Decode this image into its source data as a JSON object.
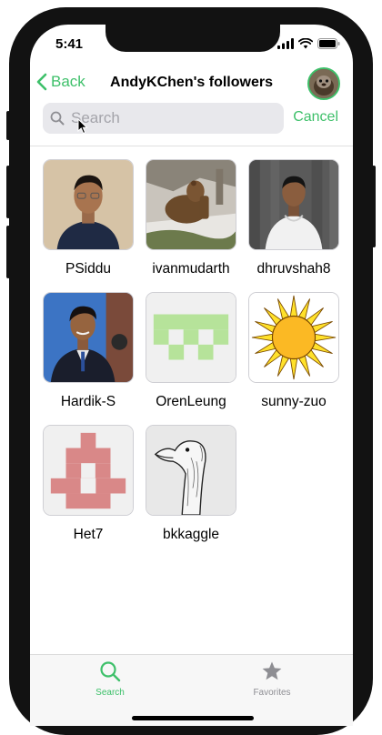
{
  "status_bar": {
    "time": "5:41"
  },
  "nav": {
    "back_label": "Back",
    "title": "AndyKChen's followers"
  },
  "search": {
    "placeholder": "Search",
    "value": "",
    "cancel_label": "Cancel"
  },
  "followers": [
    {
      "username": "PSiddu"
    },
    {
      "username": "ivanmudarth"
    },
    {
      "username": "dhruvshah8"
    },
    {
      "username": "Hardik-S"
    },
    {
      "username": "OrenLeung"
    },
    {
      "username": "sunny-zuo"
    },
    {
      "username": "Het7"
    },
    {
      "username": "bkkaggle"
    }
  ],
  "tabbar": {
    "tabs": [
      {
        "label": "Search",
        "icon": "search-icon",
        "active": true
      },
      {
        "label": "Favorites",
        "icon": "star-icon",
        "active": false
      }
    ]
  },
  "colors": {
    "accent": "#3ec06a",
    "inactive": "#8e8e93"
  }
}
